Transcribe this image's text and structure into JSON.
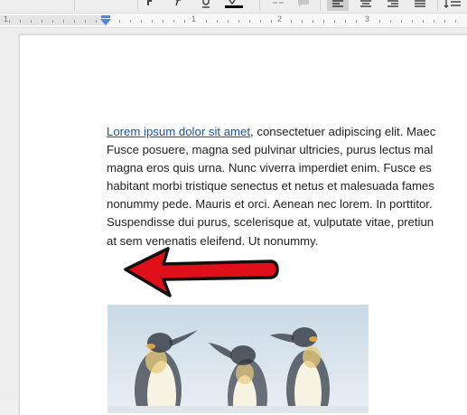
{
  "toolbar": {
    "icons": [
      "bold-icon",
      "italic-icon",
      "underline-icon",
      "text-color-icon",
      "link-icon",
      "comment-icon",
      "align-left-icon",
      "align-center-icon",
      "align-right-icon",
      "align-justify-icon",
      "line-spacing-icon"
    ],
    "active": "align-left-icon"
  },
  "ruler": {
    "numbers": [
      "1",
      "1",
      "2",
      "3"
    ]
  },
  "document": {
    "link_text": "Lorem ipsum dolor sit amet",
    "line1_rest": ", consectetuer adipiscing elit. Maec",
    "lines": [
      "Fusce posuere, magna sed pulvinar ultricies, purus lectus mal",
      "magna eros quis urna. Nunc viverra imperdiet enim. Fusce es",
      "habitant morbi tristique senectus et netus et malesuada fames",
      "nonummy pede. Mauris et orci. Aenean nec lorem. In porttitor.",
      "Suspendisse dui purus, scelerisque at, vulputate vitae, pretiun",
      "at sem venenatis eleifend. Ut nonummy."
    ],
    "image": "penguins-image"
  },
  "colors": {
    "link": "#1f4fa8",
    "arrow_fill": "#e0101a",
    "arrow_stroke": "#111111",
    "marker": "#4a86e8"
  }
}
